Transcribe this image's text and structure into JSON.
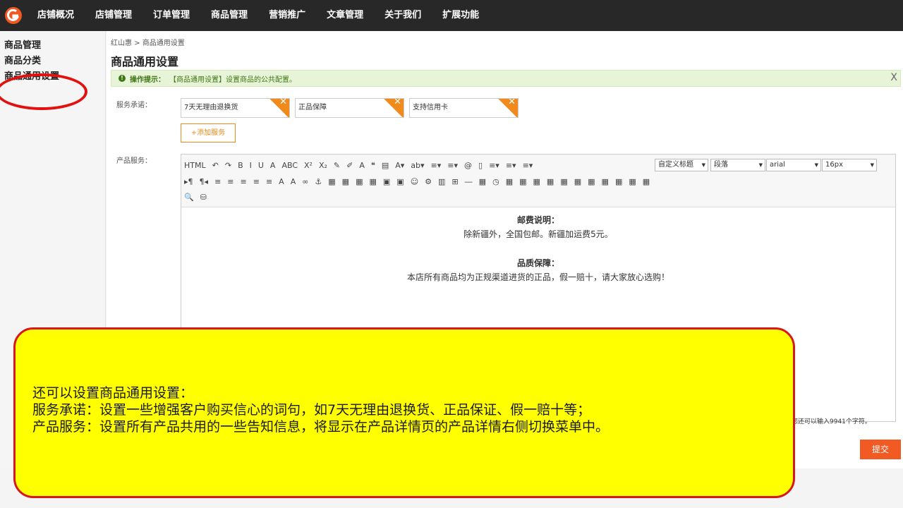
{
  "nav": {
    "items": [
      "店铺概况",
      "店铺管理",
      "订单管理",
      "商品管理",
      "营销推广",
      "文章管理",
      "关于我们",
      "扩展功能"
    ]
  },
  "sidebar": {
    "items": [
      "商品管理",
      "商品分类",
      "商品通用设置"
    ]
  },
  "breadcrumb": "红山惠 > 商品通用设置",
  "page_title": "商品通用设置",
  "tip": {
    "label": "操作提示：",
    "text": "【商品通用设置】设置商品的公共配置。",
    "close": "X"
  },
  "service": {
    "label": "服务承诺：",
    "tags": [
      "7天无理由退换货",
      "正品保障",
      "支持信用卡"
    ],
    "add_label": "+添加服务"
  },
  "product_service": {
    "label": "产品服务："
  },
  "editor": {
    "dropdowns": {
      "heading": "自定义标题",
      "paragraph": "段落",
      "font": "arial",
      "size": "16px"
    },
    "toolbar_row1": [
      "HTML",
      "↶",
      "↷",
      "B",
      "I",
      "U",
      "A",
      "ABC",
      "X²",
      "X₂",
      "✎",
      "✐",
      "A",
      "❝",
      "▤",
      "A▾",
      "ab▾",
      "≡▾",
      "≡▾",
      "@",
      "▯",
      "≡▾",
      "≡▾",
      "≡▾"
    ],
    "toolbar_row2": [
      "▸¶",
      "¶◂",
      "≡",
      "≡",
      "≡",
      "≡",
      "≡",
      "A",
      "A",
      "∞",
      "⚓",
      "▦",
      "▦",
      "▦",
      "▦",
      "▣",
      "▣",
      "☺",
      "⚙",
      "▥",
      "⊞",
      "―",
      "▦",
      "◷",
      "▦",
      "▦",
      "▦",
      "▦",
      "▦",
      "▦",
      "▦",
      "▦",
      "▦",
      "▦",
      "▦"
    ],
    "toolbar_row3": [
      "🔍",
      "⛁"
    ],
    "content": [
      {
        "type": "heading",
        "text": "邮费说明："
      },
      {
        "type": "para",
        "text": "除新疆外，全国包邮。新疆加运费5元。"
      },
      {
        "type": "heading",
        "text": "品质保障："
      },
      {
        "type": "para",
        "text": "本店所有商品均为正规渠道进货的正品，假一赔十，请大家放心选购！"
      }
    ],
    "char_count": "您还可以输入9941个字符。"
  },
  "submit_label": "提交",
  "callout": {
    "lines": [
      "还可以设置商品通用设置：",
      "服务承诺：设置一些增强客户购买信心的词句，如7天无理由退换货、正品保证、假一赔十等；",
      "产品服务：设置所有产品共用的一些告知信息，将显示在产品详情页的产品详情右侧切换菜单中。"
    ]
  }
}
